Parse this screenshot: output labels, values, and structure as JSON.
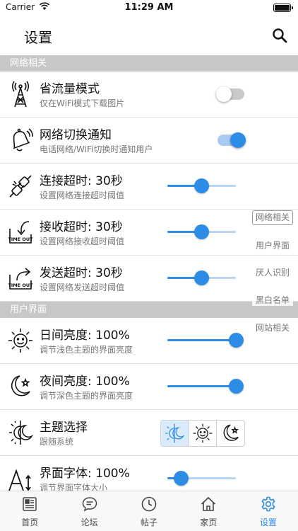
{
  "status_bar": {
    "carrier": "Carrier",
    "time": "11:29 AM"
  },
  "nav": {
    "title": "设置",
    "search_icon": "search-icon"
  },
  "sections": [
    {
      "title": "网络相关"
    },
    {
      "title": "用户界面"
    }
  ],
  "rows": [
    {
      "title": "省流量模式",
      "subtitle": "仅在WiFi模式下载图片",
      "icon": "antenna-tower-icon",
      "control": "toggle",
      "on": false
    },
    {
      "title": "网络切换通知",
      "subtitle": "电话网络/WiFi切换时通知用户",
      "icon": "bell-ringing-icon",
      "control": "toggle",
      "on": true
    },
    {
      "title": "连接超时: 30秒",
      "subtitle": "设置网络连接超时阈值",
      "icon": "plug-connect-icon",
      "control": "slider",
      "value": 0.5
    },
    {
      "title": "接收超时: 30秒",
      "subtitle": "设置网络接收超时阈值",
      "icon": "receive-timeout-icon",
      "control": "slider",
      "value": 0.5
    },
    {
      "title": "发送超时: 30秒",
      "subtitle": "设置网络发送超时阈值",
      "icon": "send-timeout-icon",
      "control": "slider",
      "value": 0.5
    },
    {
      "title": "日间亮度: 100%",
      "subtitle": "调节浅色主题的界面亮度",
      "icon": "sun-face-icon",
      "control": "slider",
      "value": 1.0
    },
    {
      "title": "夜间亮度: 100%",
      "subtitle": "调节深色主题的界面亮度",
      "icon": "moon-star-icon",
      "control": "slider",
      "value": 1.0
    },
    {
      "title": "主题选择",
      "subtitle": "跟随系统",
      "icon": "sun-moon-icon",
      "control": "theme",
      "selected": 0
    },
    {
      "title": "界面字体: 100%",
      "subtitle": "调节界面字体大小",
      "icon": "font-size-icon",
      "control": "slider",
      "value": 0.2
    }
  ],
  "side_index": [
    {
      "label": "网络相关",
      "active": true
    },
    {
      "label": "用户界面",
      "active": false
    },
    {
      "label": "厌人识别",
      "active": false
    },
    {
      "label": "黑白名单",
      "active": false
    },
    {
      "label": "网站相关",
      "active": false
    }
  ],
  "tabs": [
    {
      "label": "首页",
      "icon": "newspaper-icon",
      "active": false
    },
    {
      "label": "论坛",
      "icon": "chat-bubble-icon",
      "active": false
    },
    {
      "label": "帖子",
      "icon": "clock-icon",
      "active": false
    },
    {
      "label": "家页",
      "icon": "home-icon",
      "active": false
    },
    {
      "label": "设置",
      "icon": "gear-icon",
      "active": true
    }
  ],
  "colors": {
    "accent": "#2d8ce6",
    "section_bg": "#c7c7c7",
    "slider_track": "#b7d6f4"
  }
}
